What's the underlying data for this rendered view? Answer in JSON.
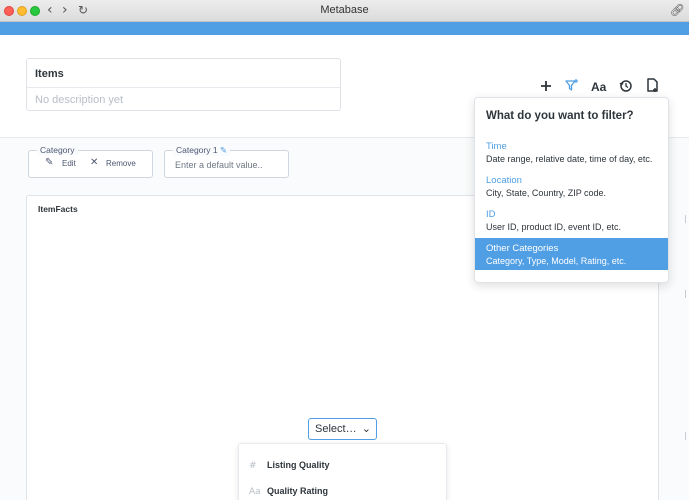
{
  "window": {
    "title": "Metabase"
  },
  "header_card": {
    "title": "Items",
    "description_placeholder": "No description yet"
  },
  "toolbar": {
    "add_icon": "plus-icon",
    "filter_icon": "filter-plus-icon",
    "text_icon": "text-card-icon",
    "text_glyph": "Aa",
    "history_icon": "history-icon",
    "save_icon": "save-icon"
  },
  "filters": [
    {
      "label": "Category",
      "edit_label": "Edit",
      "remove_label": "Remove"
    },
    {
      "label": "Category 1",
      "placeholder": "Enter a default value.."
    }
  ],
  "card": {
    "title": "ItemFacts",
    "select_label": "Select…",
    "list": [
      {
        "icon": "#",
        "label": "Listing Quality"
      },
      {
        "icon": "Aa",
        "label": "Quality Rating"
      }
    ]
  },
  "filter_popover": {
    "heading": "What do you want to filter?",
    "options": [
      {
        "name": "Time",
        "desc": "Date range, relative date, time of day, etc."
      },
      {
        "name": "Location",
        "desc": "City, State, Country, ZIP code."
      },
      {
        "name": "ID",
        "desc": "User ID, product ID, event ID, etc."
      },
      {
        "name": "Other Categories",
        "desc": "Category, Type, Model, Rating, etc."
      }
    ],
    "selected_index": 3
  },
  "colors": {
    "brand": "#509ee3",
    "text": "#2e353b",
    "muted": "#b8bec6"
  }
}
